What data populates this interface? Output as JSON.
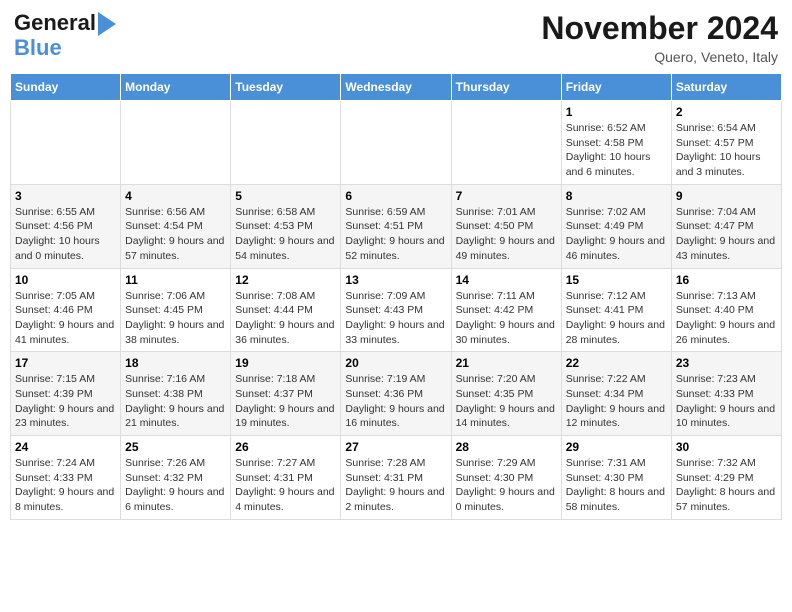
{
  "logo": {
    "line1": "General",
    "line2": "Blue"
  },
  "header": {
    "title": "November 2024",
    "location": "Quero, Veneto, Italy"
  },
  "weekdays": [
    "Sunday",
    "Monday",
    "Tuesday",
    "Wednesday",
    "Thursday",
    "Friday",
    "Saturday"
  ],
  "weeks": [
    [
      {
        "day": "",
        "info": ""
      },
      {
        "day": "",
        "info": ""
      },
      {
        "day": "",
        "info": ""
      },
      {
        "day": "",
        "info": ""
      },
      {
        "day": "",
        "info": ""
      },
      {
        "day": "1",
        "info": "Sunrise: 6:52 AM\nSunset: 4:58 PM\nDaylight: 10 hours and 6 minutes."
      },
      {
        "day": "2",
        "info": "Sunrise: 6:54 AM\nSunset: 4:57 PM\nDaylight: 10 hours and 3 minutes."
      }
    ],
    [
      {
        "day": "3",
        "info": "Sunrise: 6:55 AM\nSunset: 4:56 PM\nDaylight: 10 hours and 0 minutes."
      },
      {
        "day": "4",
        "info": "Sunrise: 6:56 AM\nSunset: 4:54 PM\nDaylight: 9 hours and 57 minutes."
      },
      {
        "day": "5",
        "info": "Sunrise: 6:58 AM\nSunset: 4:53 PM\nDaylight: 9 hours and 54 minutes."
      },
      {
        "day": "6",
        "info": "Sunrise: 6:59 AM\nSunset: 4:51 PM\nDaylight: 9 hours and 52 minutes."
      },
      {
        "day": "7",
        "info": "Sunrise: 7:01 AM\nSunset: 4:50 PM\nDaylight: 9 hours and 49 minutes."
      },
      {
        "day": "8",
        "info": "Sunrise: 7:02 AM\nSunset: 4:49 PM\nDaylight: 9 hours and 46 minutes."
      },
      {
        "day": "9",
        "info": "Sunrise: 7:04 AM\nSunset: 4:47 PM\nDaylight: 9 hours and 43 minutes."
      }
    ],
    [
      {
        "day": "10",
        "info": "Sunrise: 7:05 AM\nSunset: 4:46 PM\nDaylight: 9 hours and 41 minutes."
      },
      {
        "day": "11",
        "info": "Sunrise: 7:06 AM\nSunset: 4:45 PM\nDaylight: 9 hours and 38 minutes."
      },
      {
        "day": "12",
        "info": "Sunrise: 7:08 AM\nSunset: 4:44 PM\nDaylight: 9 hours and 36 minutes."
      },
      {
        "day": "13",
        "info": "Sunrise: 7:09 AM\nSunset: 4:43 PM\nDaylight: 9 hours and 33 minutes."
      },
      {
        "day": "14",
        "info": "Sunrise: 7:11 AM\nSunset: 4:42 PM\nDaylight: 9 hours and 30 minutes."
      },
      {
        "day": "15",
        "info": "Sunrise: 7:12 AM\nSunset: 4:41 PM\nDaylight: 9 hours and 28 minutes."
      },
      {
        "day": "16",
        "info": "Sunrise: 7:13 AM\nSunset: 4:40 PM\nDaylight: 9 hours and 26 minutes."
      }
    ],
    [
      {
        "day": "17",
        "info": "Sunrise: 7:15 AM\nSunset: 4:39 PM\nDaylight: 9 hours and 23 minutes."
      },
      {
        "day": "18",
        "info": "Sunrise: 7:16 AM\nSunset: 4:38 PM\nDaylight: 9 hours and 21 minutes."
      },
      {
        "day": "19",
        "info": "Sunrise: 7:18 AM\nSunset: 4:37 PM\nDaylight: 9 hours and 19 minutes."
      },
      {
        "day": "20",
        "info": "Sunrise: 7:19 AM\nSunset: 4:36 PM\nDaylight: 9 hours and 16 minutes."
      },
      {
        "day": "21",
        "info": "Sunrise: 7:20 AM\nSunset: 4:35 PM\nDaylight: 9 hours and 14 minutes."
      },
      {
        "day": "22",
        "info": "Sunrise: 7:22 AM\nSunset: 4:34 PM\nDaylight: 9 hours and 12 minutes."
      },
      {
        "day": "23",
        "info": "Sunrise: 7:23 AM\nSunset: 4:33 PM\nDaylight: 9 hours and 10 minutes."
      }
    ],
    [
      {
        "day": "24",
        "info": "Sunrise: 7:24 AM\nSunset: 4:33 PM\nDaylight: 9 hours and 8 minutes."
      },
      {
        "day": "25",
        "info": "Sunrise: 7:26 AM\nSunset: 4:32 PM\nDaylight: 9 hours and 6 minutes."
      },
      {
        "day": "26",
        "info": "Sunrise: 7:27 AM\nSunset: 4:31 PM\nDaylight: 9 hours and 4 minutes."
      },
      {
        "day": "27",
        "info": "Sunrise: 7:28 AM\nSunset: 4:31 PM\nDaylight: 9 hours and 2 minutes."
      },
      {
        "day": "28",
        "info": "Sunrise: 7:29 AM\nSunset: 4:30 PM\nDaylight: 9 hours and 0 minutes."
      },
      {
        "day": "29",
        "info": "Sunrise: 7:31 AM\nSunset: 4:30 PM\nDaylight: 8 hours and 58 minutes."
      },
      {
        "day": "30",
        "info": "Sunrise: 7:32 AM\nSunset: 4:29 PM\nDaylight: 8 hours and 57 minutes."
      }
    ]
  ]
}
